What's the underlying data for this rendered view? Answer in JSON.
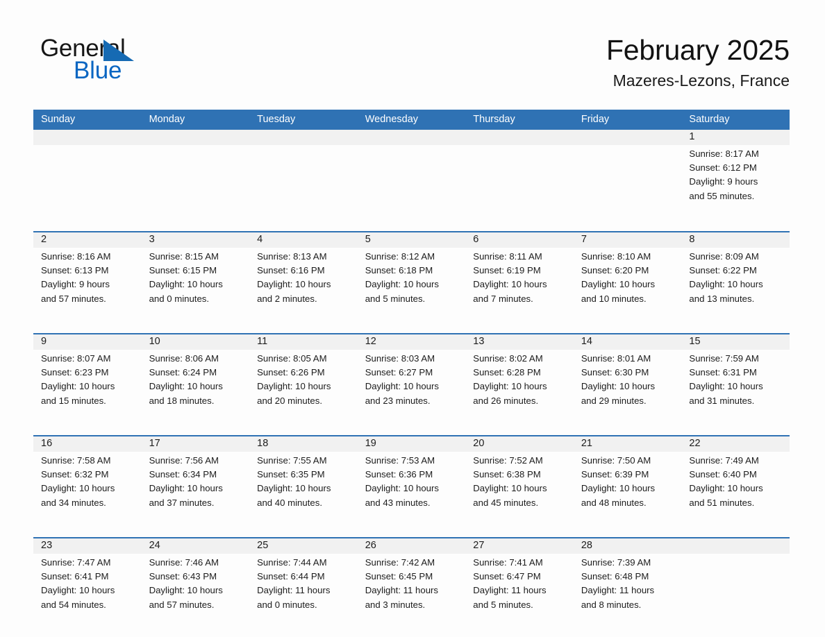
{
  "brand": {
    "name_part1": "General",
    "name_part2": "Blue",
    "triangle_color": "#166ab3",
    "blue_color": "#0a66c2"
  },
  "header": {
    "month_title": "February 2025",
    "location": "Mazeres-Lezons, France"
  },
  "theme": {
    "header_blue": "#2f72b4",
    "row_border_blue": "#2f72b4",
    "daynum_band": "#f1f1f1",
    "page_background": "#fdfdfd",
    "text": "#1c1c1c"
  },
  "calendar": {
    "weekdays": [
      "Sunday",
      "Monday",
      "Tuesday",
      "Wednesday",
      "Thursday",
      "Friday",
      "Saturday"
    ],
    "weeks": [
      [
        {
          "day": "",
          "sunrise": "",
          "sunset": "",
          "daylight_line1": "",
          "daylight_line2": ""
        },
        {
          "day": "",
          "sunrise": "",
          "sunset": "",
          "daylight_line1": "",
          "daylight_line2": ""
        },
        {
          "day": "",
          "sunrise": "",
          "sunset": "",
          "daylight_line1": "",
          "daylight_line2": ""
        },
        {
          "day": "",
          "sunrise": "",
          "sunset": "",
          "daylight_line1": "",
          "daylight_line2": ""
        },
        {
          "day": "",
          "sunrise": "",
          "sunset": "",
          "daylight_line1": "",
          "daylight_line2": ""
        },
        {
          "day": "",
          "sunrise": "",
          "sunset": "",
          "daylight_line1": "",
          "daylight_line2": ""
        },
        {
          "day": "1",
          "sunrise": "Sunrise: 8:17 AM",
          "sunset": "Sunset: 6:12 PM",
          "daylight_line1": "Daylight: 9 hours",
          "daylight_line2": "and 55 minutes."
        }
      ],
      [
        {
          "day": "2",
          "sunrise": "Sunrise: 8:16 AM",
          "sunset": "Sunset: 6:13 PM",
          "daylight_line1": "Daylight: 9 hours",
          "daylight_line2": "and 57 minutes."
        },
        {
          "day": "3",
          "sunrise": "Sunrise: 8:15 AM",
          "sunset": "Sunset: 6:15 PM",
          "daylight_line1": "Daylight: 10 hours",
          "daylight_line2": "and 0 minutes."
        },
        {
          "day": "4",
          "sunrise": "Sunrise: 8:13 AM",
          "sunset": "Sunset: 6:16 PM",
          "daylight_line1": "Daylight: 10 hours",
          "daylight_line2": "and 2 minutes."
        },
        {
          "day": "5",
          "sunrise": "Sunrise: 8:12 AM",
          "sunset": "Sunset: 6:18 PM",
          "daylight_line1": "Daylight: 10 hours",
          "daylight_line2": "and 5 minutes."
        },
        {
          "day": "6",
          "sunrise": "Sunrise: 8:11 AM",
          "sunset": "Sunset: 6:19 PM",
          "daylight_line1": "Daylight: 10 hours",
          "daylight_line2": "and 7 minutes."
        },
        {
          "day": "7",
          "sunrise": "Sunrise: 8:10 AM",
          "sunset": "Sunset: 6:20 PM",
          "daylight_line1": "Daylight: 10 hours",
          "daylight_line2": "and 10 minutes."
        },
        {
          "day": "8",
          "sunrise": "Sunrise: 8:09 AM",
          "sunset": "Sunset: 6:22 PM",
          "daylight_line1": "Daylight: 10 hours",
          "daylight_line2": "and 13 minutes."
        }
      ],
      [
        {
          "day": "9",
          "sunrise": "Sunrise: 8:07 AM",
          "sunset": "Sunset: 6:23 PM",
          "daylight_line1": "Daylight: 10 hours",
          "daylight_line2": "and 15 minutes."
        },
        {
          "day": "10",
          "sunrise": "Sunrise: 8:06 AM",
          "sunset": "Sunset: 6:24 PM",
          "daylight_line1": "Daylight: 10 hours",
          "daylight_line2": "and 18 minutes."
        },
        {
          "day": "11",
          "sunrise": "Sunrise: 8:05 AM",
          "sunset": "Sunset: 6:26 PM",
          "daylight_line1": "Daylight: 10 hours",
          "daylight_line2": "and 20 minutes."
        },
        {
          "day": "12",
          "sunrise": "Sunrise: 8:03 AM",
          "sunset": "Sunset: 6:27 PM",
          "daylight_line1": "Daylight: 10 hours",
          "daylight_line2": "and 23 minutes."
        },
        {
          "day": "13",
          "sunrise": "Sunrise: 8:02 AM",
          "sunset": "Sunset: 6:28 PM",
          "daylight_line1": "Daylight: 10 hours",
          "daylight_line2": "and 26 minutes."
        },
        {
          "day": "14",
          "sunrise": "Sunrise: 8:01 AM",
          "sunset": "Sunset: 6:30 PM",
          "daylight_line1": "Daylight: 10 hours",
          "daylight_line2": "and 29 minutes."
        },
        {
          "day": "15",
          "sunrise": "Sunrise: 7:59 AM",
          "sunset": "Sunset: 6:31 PM",
          "daylight_line1": "Daylight: 10 hours",
          "daylight_line2": "and 31 minutes."
        }
      ],
      [
        {
          "day": "16",
          "sunrise": "Sunrise: 7:58 AM",
          "sunset": "Sunset: 6:32 PM",
          "daylight_line1": "Daylight: 10 hours",
          "daylight_line2": "and 34 minutes."
        },
        {
          "day": "17",
          "sunrise": "Sunrise: 7:56 AM",
          "sunset": "Sunset: 6:34 PM",
          "daylight_line1": "Daylight: 10 hours",
          "daylight_line2": "and 37 minutes."
        },
        {
          "day": "18",
          "sunrise": "Sunrise: 7:55 AM",
          "sunset": "Sunset: 6:35 PM",
          "daylight_line1": "Daylight: 10 hours",
          "daylight_line2": "and 40 minutes."
        },
        {
          "day": "19",
          "sunrise": "Sunrise: 7:53 AM",
          "sunset": "Sunset: 6:36 PM",
          "daylight_line1": "Daylight: 10 hours",
          "daylight_line2": "and 43 minutes."
        },
        {
          "day": "20",
          "sunrise": "Sunrise: 7:52 AM",
          "sunset": "Sunset: 6:38 PM",
          "daylight_line1": "Daylight: 10 hours",
          "daylight_line2": "and 45 minutes."
        },
        {
          "day": "21",
          "sunrise": "Sunrise: 7:50 AM",
          "sunset": "Sunset: 6:39 PM",
          "daylight_line1": "Daylight: 10 hours",
          "daylight_line2": "and 48 minutes."
        },
        {
          "day": "22",
          "sunrise": "Sunrise: 7:49 AM",
          "sunset": "Sunset: 6:40 PM",
          "daylight_line1": "Daylight: 10 hours",
          "daylight_line2": "and 51 minutes."
        }
      ],
      [
        {
          "day": "23",
          "sunrise": "Sunrise: 7:47 AM",
          "sunset": "Sunset: 6:41 PM",
          "daylight_line1": "Daylight: 10 hours",
          "daylight_line2": "and 54 minutes."
        },
        {
          "day": "24",
          "sunrise": "Sunrise: 7:46 AM",
          "sunset": "Sunset: 6:43 PM",
          "daylight_line1": "Daylight: 10 hours",
          "daylight_line2": "and 57 minutes."
        },
        {
          "day": "25",
          "sunrise": "Sunrise: 7:44 AM",
          "sunset": "Sunset: 6:44 PM",
          "daylight_line1": "Daylight: 11 hours",
          "daylight_line2": "and 0 minutes."
        },
        {
          "day": "26",
          "sunrise": "Sunrise: 7:42 AM",
          "sunset": "Sunset: 6:45 PM",
          "daylight_line1": "Daylight: 11 hours",
          "daylight_line2": "and 3 minutes."
        },
        {
          "day": "27",
          "sunrise": "Sunrise: 7:41 AM",
          "sunset": "Sunset: 6:47 PM",
          "daylight_line1": "Daylight: 11 hours",
          "daylight_line2": "and 5 minutes."
        },
        {
          "day": "28",
          "sunrise": "Sunrise: 7:39 AM",
          "sunset": "Sunset: 6:48 PM",
          "daylight_line1": "Daylight: 11 hours",
          "daylight_line2": "and 8 minutes."
        },
        {
          "day": "",
          "sunrise": "",
          "sunset": "",
          "daylight_line1": "",
          "daylight_line2": ""
        }
      ]
    ]
  }
}
